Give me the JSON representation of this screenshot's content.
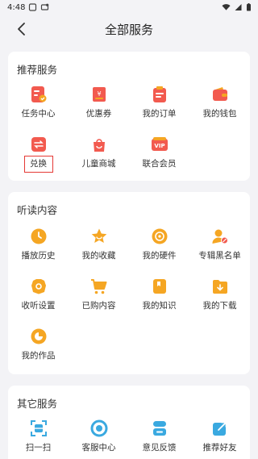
{
  "status": {
    "time": "4:48"
  },
  "header": {
    "title": "全部服务"
  },
  "recommended": {
    "title": "推荐服务",
    "items": [
      {
        "label": "任务中心",
        "icon": "task-center-icon"
      },
      {
        "label": "优惠券",
        "icon": "coupon-icon"
      },
      {
        "label": "我的订单",
        "icon": "orders-icon"
      },
      {
        "label": "我的钱包",
        "icon": "wallet-icon"
      },
      {
        "label": "兑换",
        "icon": "exchange-icon"
      },
      {
        "label": "儿童商城",
        "icon": "kids-mall-icon"
      },
      {
        "label": "联合会员",
        "icon": "vip-icon",
        "badge": "VIP"
      }
    ]
  },
  "listening": {
    "title": "听读内容",
    "items": [
      {
        "label": "播放历史",
        "icon": "history-icon"
      },
      {
        "label": "我的收藏",
        "icon": "favorites-icon"
      },
      {
        "label": "我的硬件",
        "icon": "hardware-icon"
      },
      {
        "label": "专辑黑名单",
        "icon": "album-blacklist-icon"
      },
      {
        "label": "收听设置",
        "icon": "listen-settings-icon"
      },
      {
        "label": "已购内容",
        "icon": "purchased-icon"
      },
      {
        "label": "我的知识",
        "icon": "knowledge-icon"
      },
      {
        "label": "我的下载",
        "icon": "downloads-icon"
      },
      {
        "label": "我的作品",
        "icon": "works-icon"
      }
    ]
  },
  "other": {
    "title": "其它服务",
    "items": [
      {
        "label": "扫一扫",
        "icon": "scan-icon"
      },
      {
        "label": "客服中心",
        "icon": "customer-service-icon"
      },
      {
        "label": "意见反馈",
        "icon": "feedback-icon"
      },
      {
        "label": "推荐好友",
        "icon": "share-icon"
      }
    ]
  },
  "colors": {
    "red": "#f25a4f",
    "orange": "#f5a623",
    "blue": "#3aa9e0"
  }
}
